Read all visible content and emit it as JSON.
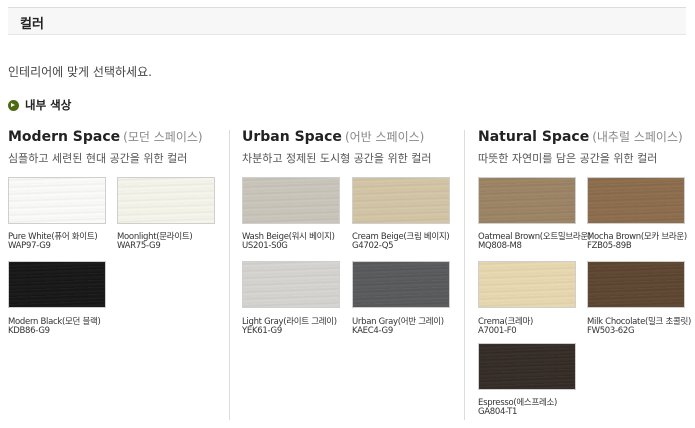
{
  "header": {
    "title": "컬러"
  },
  "intro": "인테리어에 맞게 선택하세요.",
  "section_label": "내부 색상",
  "columns": [
    {
      "title": "Modern Space",
      "title_kr": "(모던 스페이스)",
      "subtitle": "심플하고 세련된 현대 공간을 위한 컬러",
      "swatches": [
        {
          "name": "Pure White(퓨어 화이트)",
          "code": "WAP97-G9",
          "color": "#fcfcfa"
        },
        {
          "name": "Moonlight(문라이트)",
          "code": "WAR75-G9",
          "color": "#f7f6ec"
        },
        {
          "name": "Modern Black(모던 블랙)",
          "code": "KDB86-G9",
          "color": "#151515"
        }
      ]
    },
    {
      "title": "Urban Space",
      "title_kr": "(어반 스페이스)",
      "subtitle": "차분하고 정제된 도시형 공간을 위한 컬러",
      "swatches": [
        {
          "name": "Wash Beige(워시 베이지)",
          "code": "US201-S0G",
          "color": "#cbc6bb"
        },
        {
          "name": "Cream Beige(크림 베이지)",
          "code": "G4702-Q5",
          "color": "#d4c6a6"
        },
        {
          "name": "Light Gray(라이트 그레이)",
          "code": "YEK61-G9",
          "color": "#d7d5d1"
        },
        {
          "name": "Urban Gray(어반 그레이)",
          "code": "KAEC4-G9",
          "color": "#58595a"
        }
      ]
    },
    {
      "title": "Natural Space",
      "title_kr": "(내추럴 스페이스)",
      "subtitle": "따뜻한 자연미를 담은 공간을 위한 컬러",
      "swatches": [
        {
          "name": "Oatmeal Brown(오트밀브라운)",
          "code": "MQ808-M8",
          "color": "#9c8464"
        },
        {
          "name": "Mocha Brown(모카 브라운)",
          "code": "FZB05-89B",
          "color": "#8c6c4c"
        },
        {
          "name": "Crema(크레마)",
          "code": "A7001-F0",
          "color": "#e9d9b0"
        },
        {
          "name": "Milk Chocolate(밀크 초콜릿)",
          "code": "FW503-62G",
          "color": "#5c4530"
        },
        {
          "name": "Espresso(에스프레소)",
          "code": "GA804-T1",
          "color": "#332a24"
        }
      ]
    }
  ]
}
